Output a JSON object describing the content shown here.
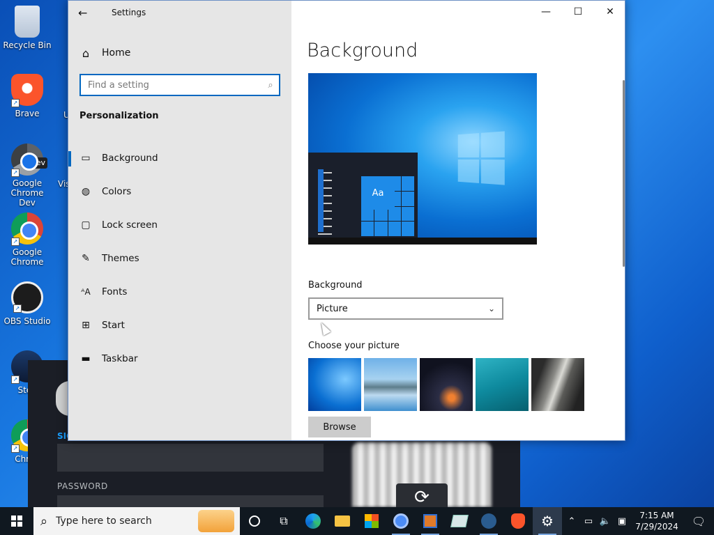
{
  "desktop": {
    "icons": [
      {
        "label": "Recycle Bin"
      },
      {
        "label": "Brave"
      },
      {
        "label": "Google Chrome Dev",
        "badge": "Dev"
      },
      {
        "label": "Google Chrome"
      },
      {
        "label": "OBS Studio"
      },
      {
        "label": "Stea"
      },
      {
        "label": "Chron"
      }
    ],
    "partial_labels": [
      "U",
      "Vis"
    ]
  },
  "steam_login": {
    "signin_label": "SIG",
    "password_label": "PASSWORD"
  },
  "settings": {
    "title": "Settings",
    "window_controls": {
      "minimize": "—",
      "maximize": "☐",
      "close": "✕"
    },
    "nav": {
      "home": "Home",
      "search_placeholder": "Find a setting",
      "section": "Personalization",
      "items": [
        {
          "label": "Background",
          "icon": "picture-icon",
          "active": true
        },
        {
          "label": "Colors",
          "icon": "palette-icon"
        },
        {
          "label": "Lock screen",
          "icon": "lock-screen-icon"
        },
        {
          "label": "Themes",
          "icon": "themes-icon"
        },
        {
          "label": "Fonts",
          "icon": "fonts-icon"
        },
        {
          "label": "Start",
          "icon": "start-icon"
        },
        {
          "label": "Taskbar",
          "icon": "taskbar-icon"
        }
      ]
    },
    "content": {
      "title": "Background",
      "preview_tile_text": "Aa",
      "background_label": "Background",
      "background_value": "Picture",
      "choose_label": "Choose your picture",
      "browse_label": "Browse"
    }
  },
  "taskbar": {
    "search_text": "Type here to search",
    "time": "7:15 AM",
    "date": "7/29/2024",
    "colors": {
      "background": "#101820",
      "accent": "#0067c0"
    }
  }
}
